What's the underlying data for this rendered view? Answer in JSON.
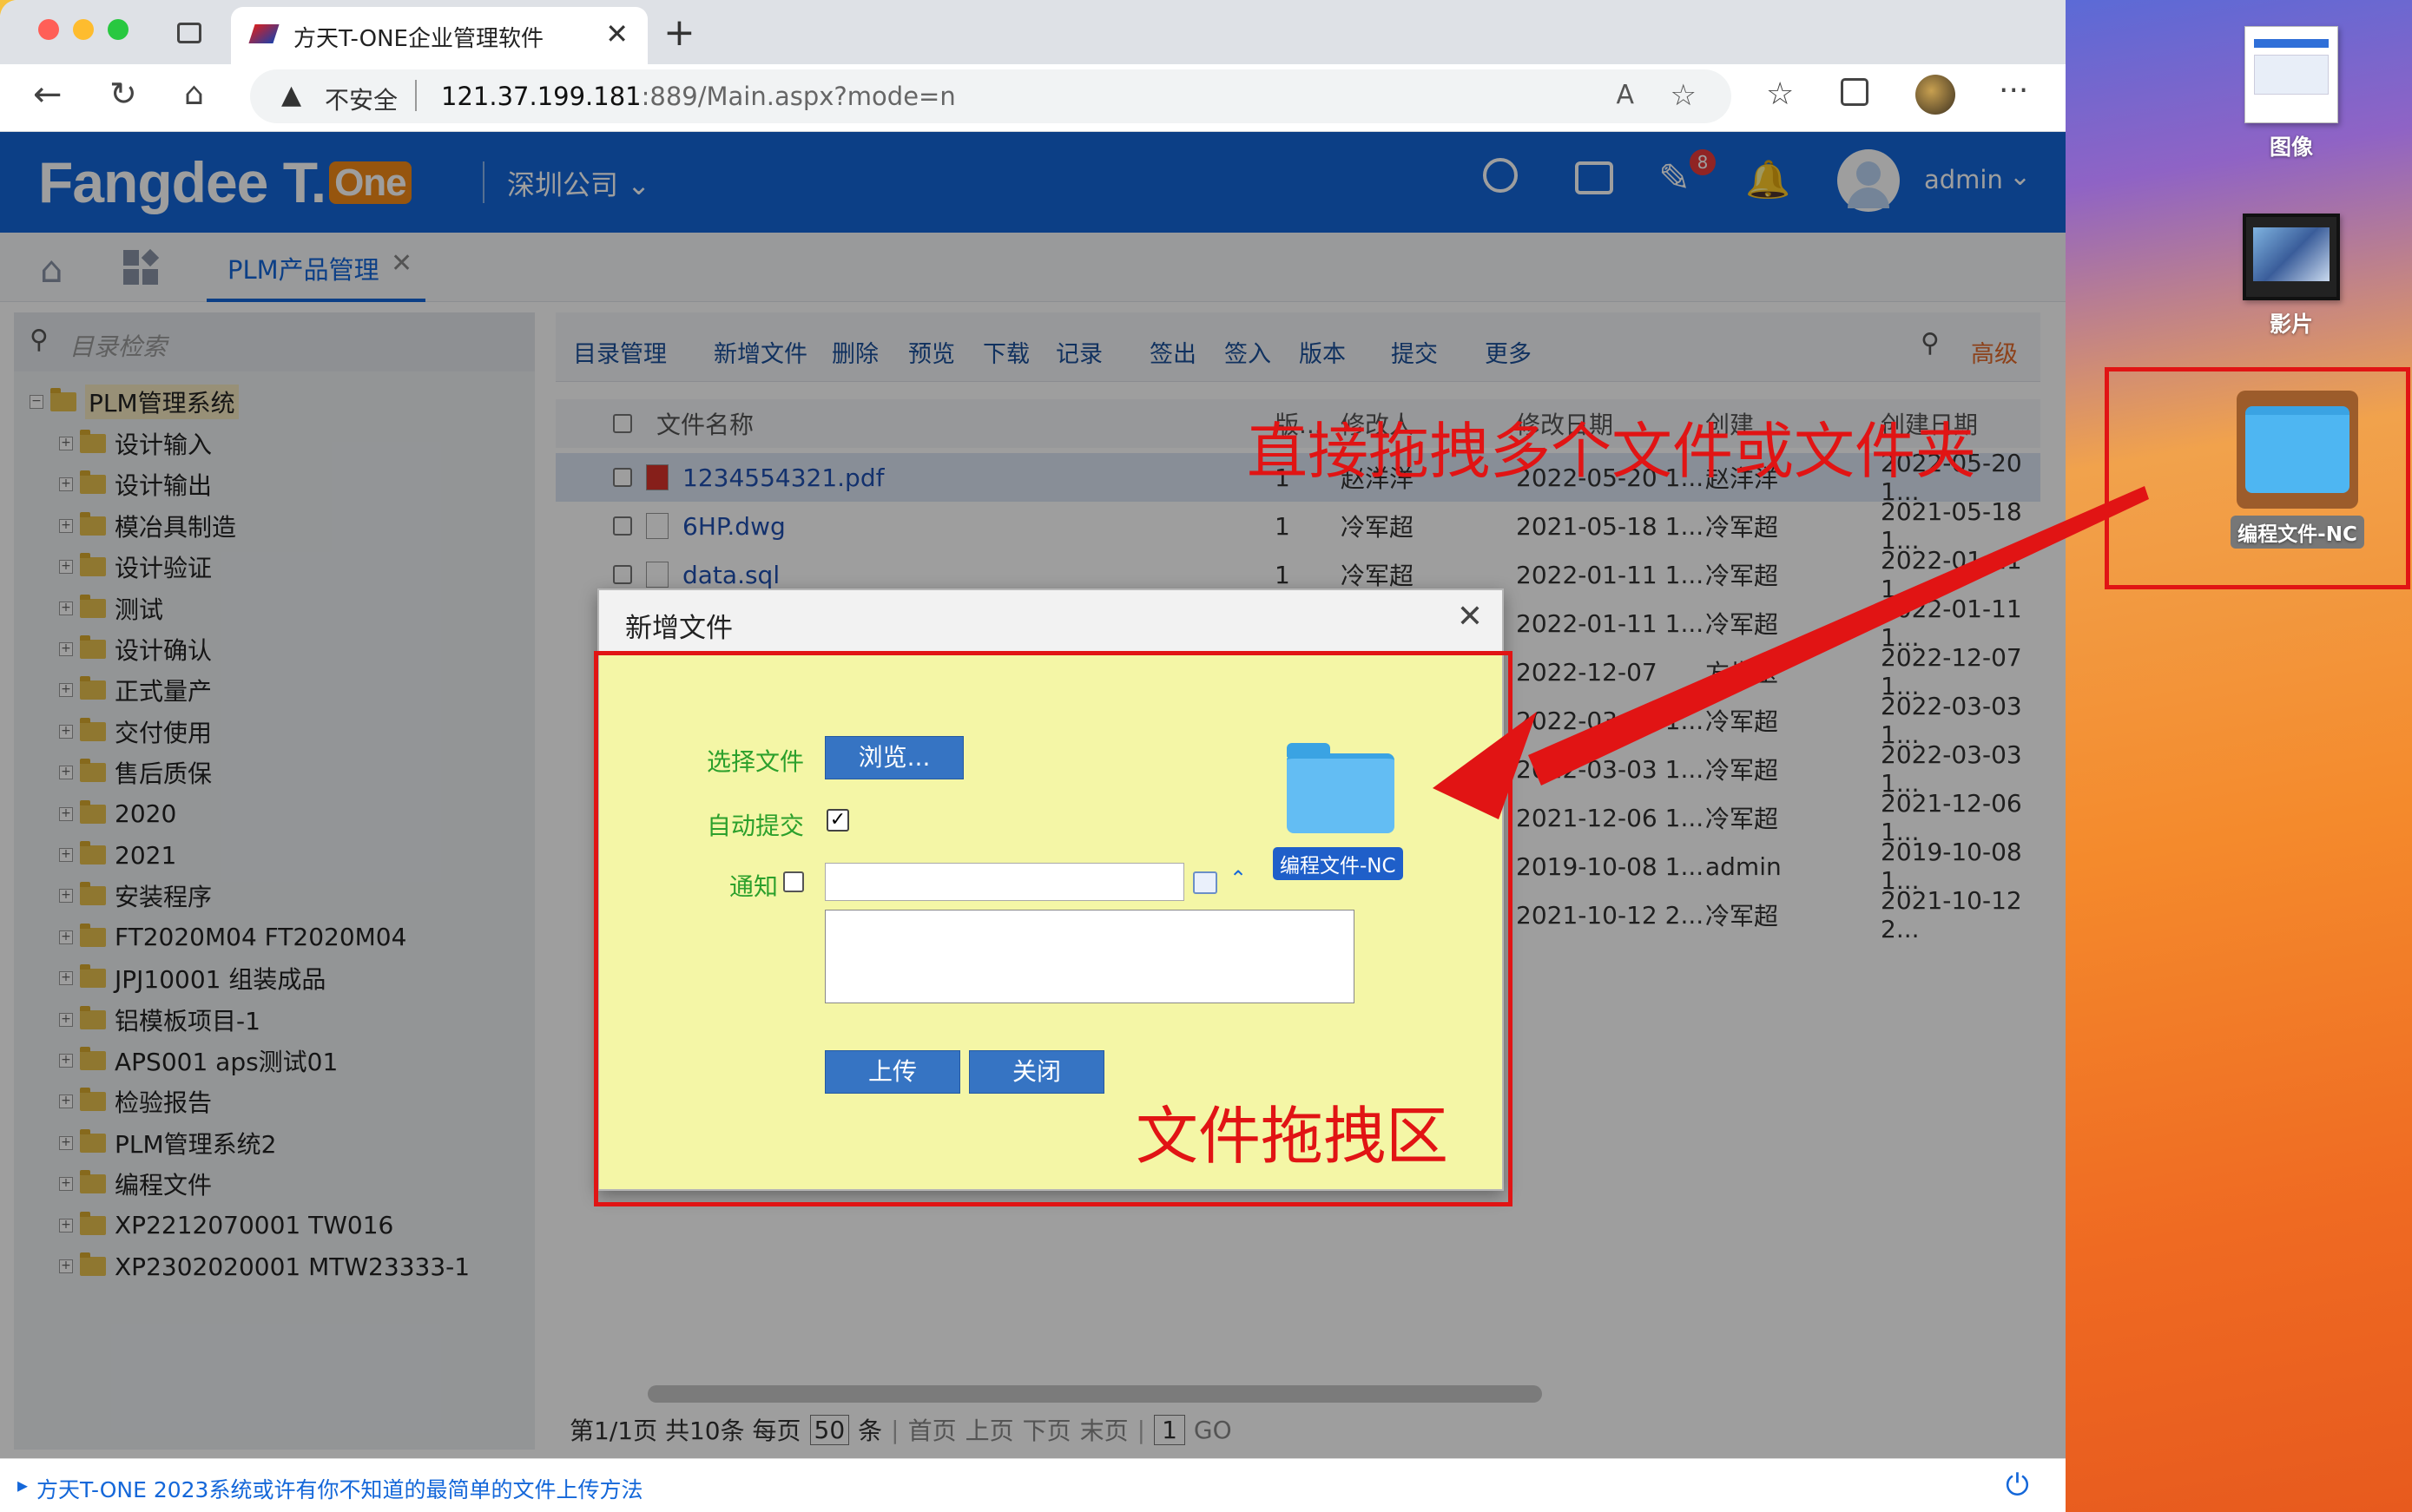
{
  "browser": {
    "tab_title": "方天T-ONE企业管理软件",
    "security_label": "不安全",
    "url_host": "121.37.199.181",
    "url_rest": ":889/Main.aspx?mode=n"
  },
  "app": {
    "logo_text": "Fangdee T.",
    "logo_badge": "One",
    "company": "深圳公司",
    "notif_count": "8",
    "user": "admin",
    "brand_color": "#1467d9"
  },
  "tabs": {
    "active": "PLM产品管理"
  },
  "sidebar": {
    "search_placeholder": "目录检索",
    "root": "PLM管理系统",
    "items": [
      "设计输入",
      "设计输出",
      "模冶具制造",
      "设计验证",
      "测试",
      "设计确认",
      "正式量产",
      "交付使用",
      "售后质保",
      "2020",
      "2021",
      "安装程序",
      "FT2020M04 FT2020M04",
      "JPJ10001 组装成品",
      "铝模板项目-1",
      "APS001 aps测试01",
      "检验报告",
      "PLM管理系统2",
      "编程文件",
      "XP2212070001 TW016",
      "XP2302020001 MTW23333-1"
    ]
  },
  "toolbar": {
    "buttons": [
      "目录管理",
      "新增文件",
      "删除",
      "预览",
      "下载",
      "记录",
      "签出",
      "签入",
      "版本",
      "提交",
      "更多"
    ],
    "advanced": "高级"
  },
  "grid": {
    "headers": [
      "文件名称",
      "版...",
      "修改人",
      "修改日期",
      "创建",
      "创建日期"
    ],
    "rows": [
      {
        "name": "1234554321.pdf",
        "ver": "1",
        "modifier": "赵洋洋",
        "mdate": "2022-05-20 1...",
        "creator": "赵洋洋",
        "cdate": "2022-05-20 1..."
      },
      {
        "name": "6HP.dwg",
        "ver": "1",
        "modifier": "冷军超",
        "mdate": "2021-05-18 1...",
        "creator": "冷军超",
        "cdate": "2021-05-18 1..."
      },
      {
        "name": "data.sql",
        "ver": "1",
        "modifier": "冷军超",
        "mdate": "2022-01-11 1...",
        "creator": "冷军超",
        "cdate": "2022-01-11 1..."
      },
      {
        "name": "",
        "ver": "",
        "modifier": "",
        "mdate": "2022-01-11 1...",
        "creator": "冷军超",
        "cdate": "2022-01-11 1..."
      },
      {
        "name": "",
        "ver": "",
        "modifier": "",
        "mdate": "2022-12-07",
        "creator": "方世玉",
        "cdate": "2022-12-07 1..."
      },
      {
        "name": "",
        "ver": "",
        "modifier": "",
        "mdate": "2022-03-03 1...",
        "creator": "冷军超",
        "cdate": "2022-03-03 1..."
      },
      {
        "name": "",
        "ver": "",
        "modifier": "",
        "mdate": "2022-03-03 1...",
        "creator": "冷军超",
        "cdate": "2022-03-03 1..."
      },
      {
        "name": "",
        "ver": "",
        "modifier": "",
        "mdate": "2021-12-06 1...",
        "creator": "冷军超",
        "cdate": "2021-12-06 1..."
      },
      {
        "name": "",
        "ver": "",
        "modifier": "",
        "mdate": "2019-10-08 1...",
        "creator": "admin",
        "cdate": "2019-10-08 1..."
      },
      {
        "name": "",
        "ver": "",
        "modifier": "",
        "mdate": "2021-10-12 2...",
        "creator": "冷军超",
        "cdate": "2021-10-12 2..."
      }
    ],
    "pager": {
      "info_a": "第1/1页 共10条 每页",
      "page_size": "50",
      "info_b": "条",
      "links": [
        "首页",
        "上页",
        "下页",
        "末页"
      ],
      "page": "1",
      "go": "GO"
    }
  },
  "dialog": {
    "title": "新增文件",
    "choose_file": "选择文件",
    "browse": "浏览...",
    "auto_submit": "自动提交",
    "notify": "通知",
    "upload": "上传",
    "close": "关闭",
    "drag_folder": "编程文件-NC"
  },
  "annotations": {
    "top": "直接拖拽多个文件或文件夹",
    "drop_zone": "文件拖拽区"
  },
  "desktop": {
    "items": [
      "图像",
      "影片",
      "编程文件-NC"
    ]
  },
  "status_bar": {
    "text": "方天T-ONE 2023系统或许有你不知道的最简单的文件上传方法"
  }
}
